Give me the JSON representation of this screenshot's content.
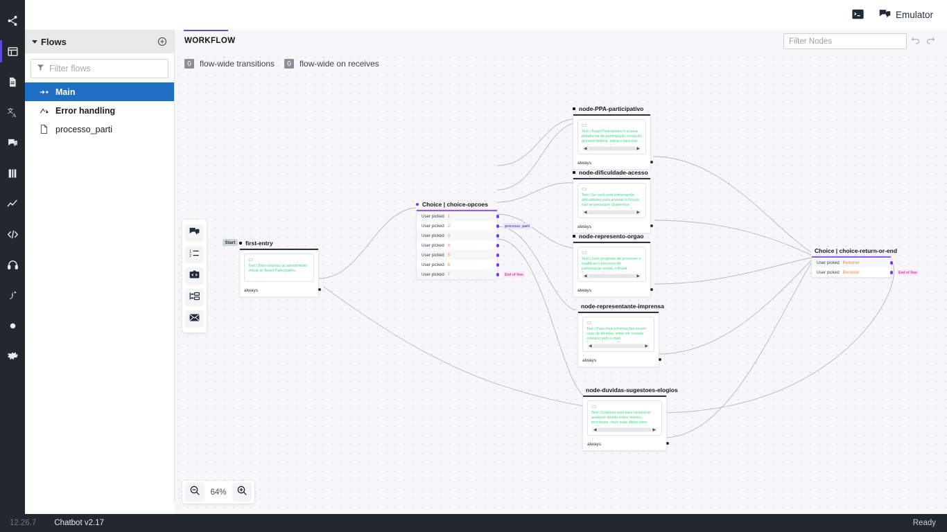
{
  "app": {
    "rail_items": [
      {
        "name": "share-nodes-icon"
      },
      {
        "name": "layout-dashboard-icon"
      },
      {
        "name": "document-icon"
      },
      {
        "name": "translate-icon"
      },
      {
        "name": "chat-bubbles-icon"
      },
      {
        "name": "book-icon"
      },
      {
        "name": "analytics-chart-icon"
      },
      {
        "name": "code-icon"
      },
      {
        "name": "headset-icon"
      },
      {
        "name": "flow-branch-icon"
      },
      {
        "name": "circle-dot-icon"
      },
      {
        "name": "gear-icon"
      }
    ]
  },
  "topbar": {
    "console_icon": "terminal-icon",
    "emulator_label": "Emulator",
    "emulator_icon": "chat-bubbles-icon"
  },
  "sidebar": {
    "title": "Flows",
    "add_icon": "plus-circle-icon",
    "filter_placeholder": "Filter flows",
    "filter_value": "",
    "filter_icon": "funnel-icon",
    "items": [
      {
        "label": "Main",
        "icon": "arrow-node-icon",
        "selected": true
      },
      {
        "label": "Error handling",
        "icon": "error-path-icon",
        "selected": false
      },
      {
        "label": "processo_parti",
        "icon": "file-icon",
        "selected": false
      }
    ]
  },
  "workflow_header": {
    "tab_label": "WORKFLOW",
    "filter_nodes_placeholder": "Filter Nodes",
    "filter_nodes_value": "",
    "undo_icon": "undo-icon",
    "redo_icon": "redo-icon"
  },
  "canvas": {
    "flow_wide": [
      {
        "count": "0",
        "label": "flow-wide transitions"
      },
      {
        "count": "0",
        "label": "flow-wide on receives"
      }
    ],
    "palette": [
      {
        "name": "say-something-icon"
      },
      {
        "name": "ask-a-question-icon"
      },
      {
        "name": "execute-code-icon"
      },
      {
        "name": "choice-split-icon"
      },
      {
        "name": "send-email-icon"
      }
    ],
    "zoom": {
      "level": "64%",
      "zoom_out_icon": "zoom-out-icon",
      "zoom_in_icon": "zoom-in-icon"
    }
  },
  "nodes": {
    "first_entry": {
      "title": "first-entry",
      "start_badge": "Start",
      "message_icon": "message-icon",
      "message_text": "Text | Bem-vindo(a) ao atendimento virtual do Brasil Participativo.",
      "transition": "always"
    },
    "choice_opcoes": {
      "title": "Choice | choice-opcoes",
      "rows": [
        {
          "label": "User picked",
          "value": "1",
          "badge": ""
        },
        {
          "label": "User picked",
          "value": "2",
          "badge": "processo_parti"
        },
        {
          "label": "User picked",
          "value": "3",
          "badge": ""
        },
        {
          "label": "User picked",
          "value": "4",
          "badge": ""
        },
        {
          "label": "User picked",
          "value": "5",
          "badge": ""
        },
        {
          "label": "User picked",
          "value": "6",
          "badge": ""
        },
        {
          "label": "User picked",
          "value": "7",
          "badge": "End of flow"
        }
      ]
    },
    "ppa_participativo": {
      "title": "node-PPA-participativo",
      "message_text": "Text | Brasil Participativo é a nova plataforma de participação social do governo federal, espaço para que você possa contribuir co...",
      "transition": "always"
    },
    "dificuldade_acesso": {
      "title": "node-dificuldade-acesso",
      "message_text": "Text | Se você está enfrentando dificuldades para acessar o Gov.br, não se preocupe! Queremos garantir que você tenha a melhor experiência possível",
      "transition": "always"
    },
    "represento_orgao": {
      "title": "node-represento-orgao",
      "message_text": "Text | Com propósito de promover e qualificar o processo de participação social, o Brasil Participativo fortalece a interação entre o governo e a sociedade, promovendo o...",
      "transition": "always"
    },
    "representante_imprensa": {
      "title": "node-representante-imprensa",
      "message_text": "Text | Para mais informações ou em caso de dúvidas, entre em contato conosco pelo e-mail: [brasilparticipativo@presidencia.gov.br](mailto:brasilparticipativo@presidencia.g...",
      "transition": "always"
    },
    "duvidas_sugestoes_elogios": {
      "title": "node-duvidas-sugestoes-elogios",
      "message_text": "Text | Estamos aqui para esclarecer qualquer dúvida sobre nossos processos, ouvir suas ideias para melhorarmos e seus elogios para nos motivar ainda mais. Por favor, nos en...",
      "transition": "always"
    },
    "choice_return_or_end": {
      "title": "Choice | choice-return-or-end",
      "rows": [
        {
          "label": "User picked",
          "value": "Retornar",
          "badge": ""
        },
        {
          "label": "User picked",
          "value": "Encerrar",
          "badge": "End of flow"
        }
      ]
    }
  },
  "status_bar": {
    "version": "12.26.7",
    "app": "Chatbot v2.17",
    "state": "Ready"
  }
}
